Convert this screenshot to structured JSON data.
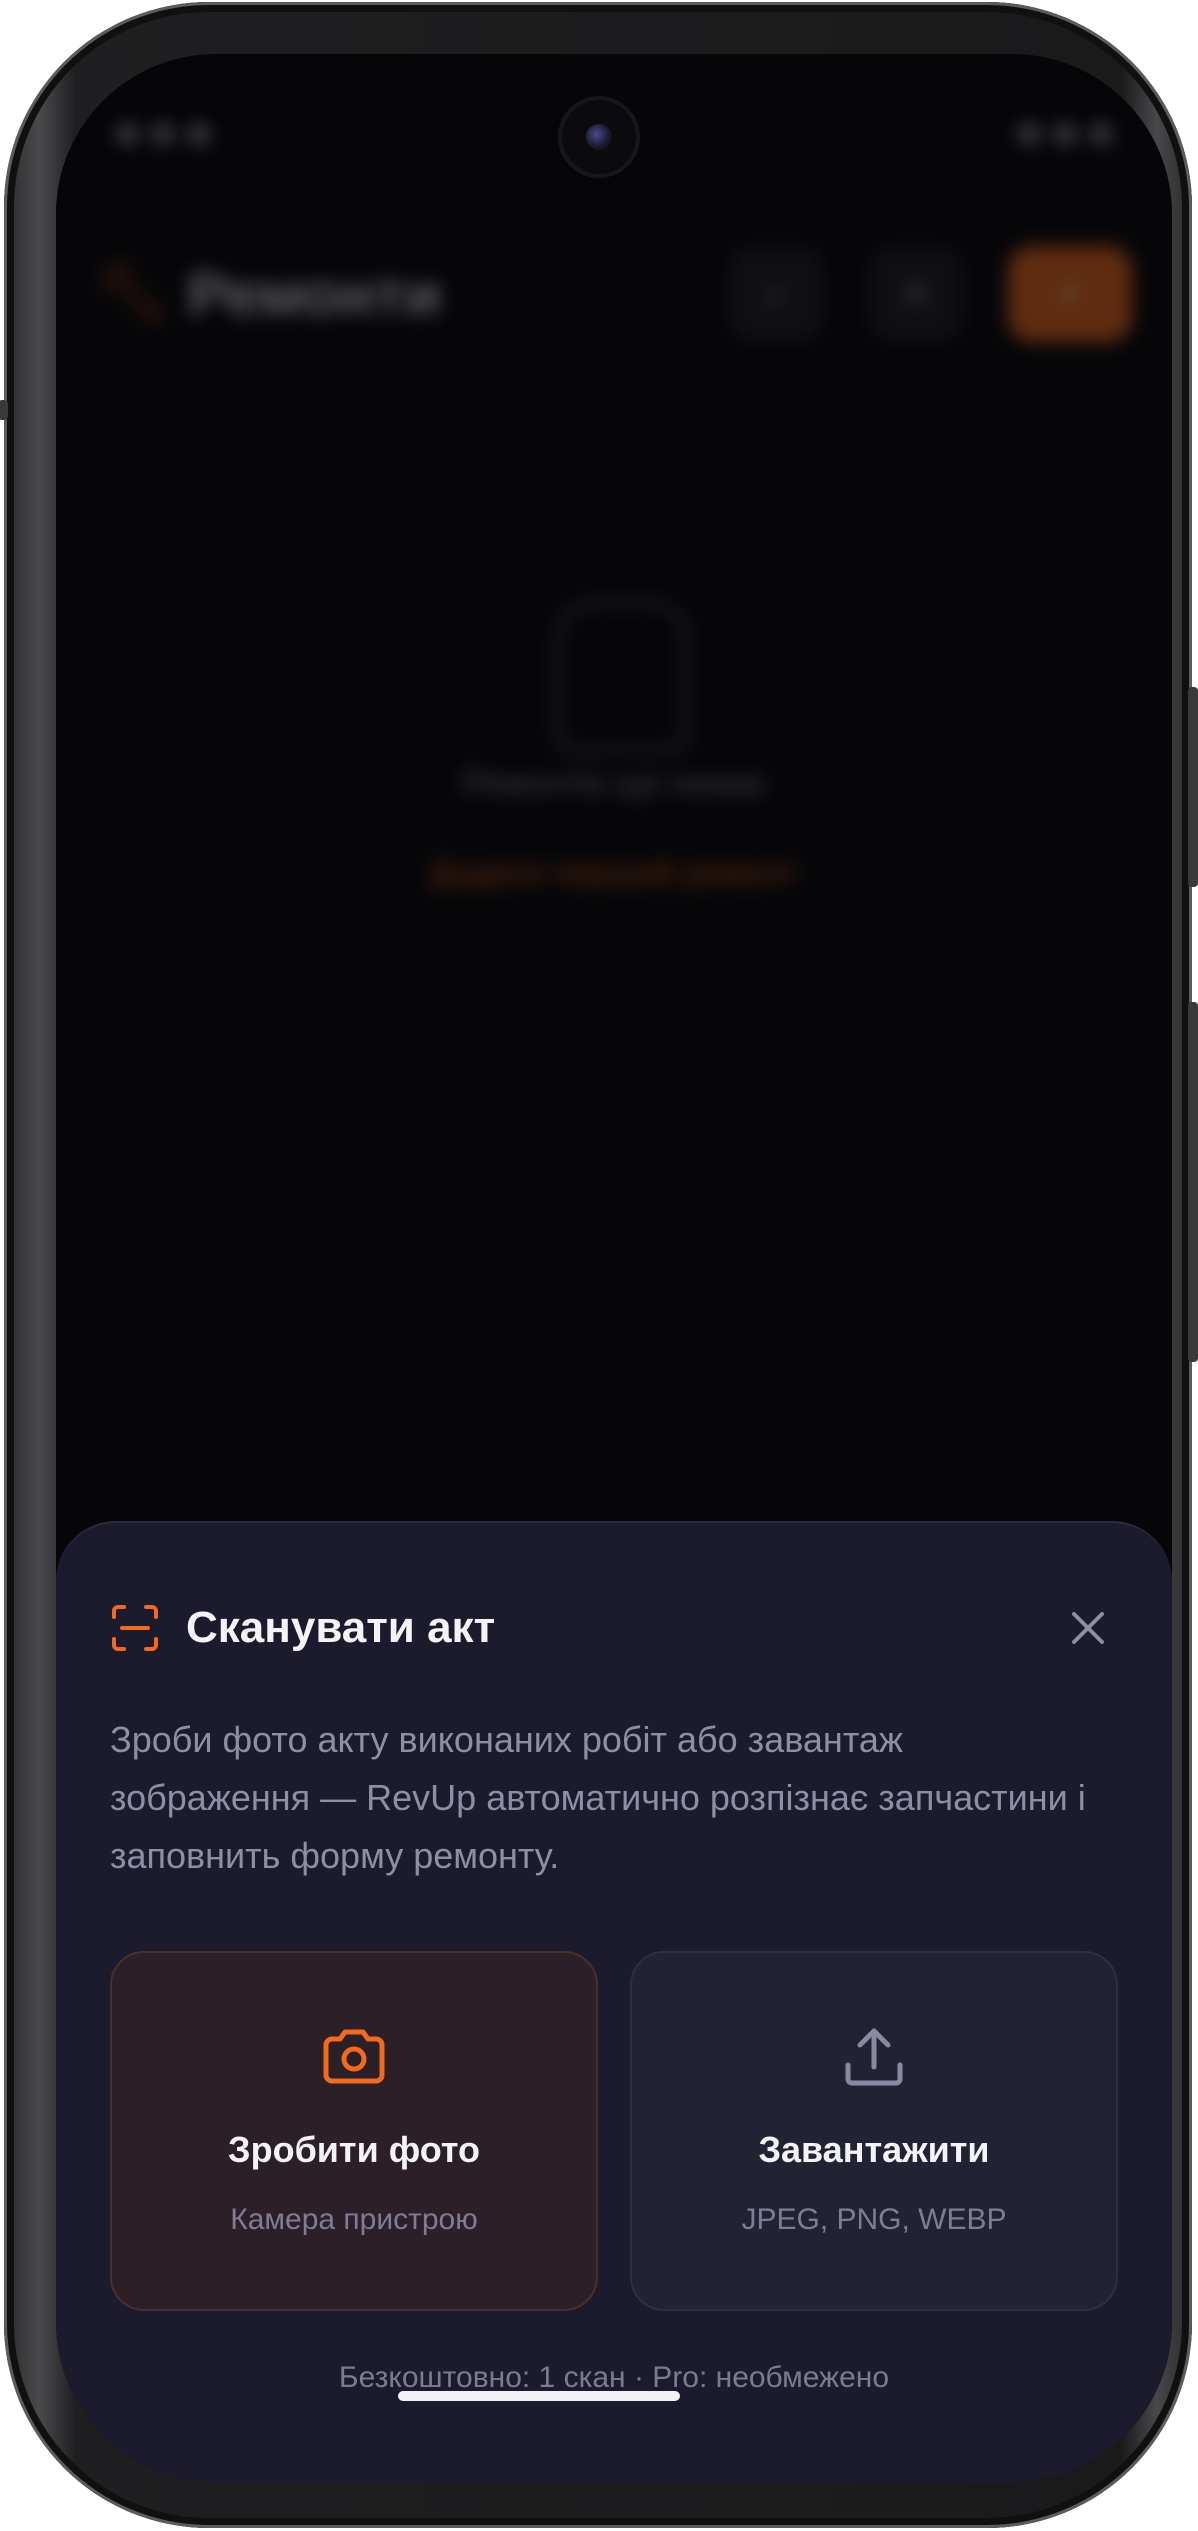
{
  "background_app": {
    "title": "Ремонти",
    "empty_text": "Ремонтів ще немає",
    "empty_link": "Додати перший ремонт",
    "header_buttons": [
      "search-icon",
      "filter-icon",
      "plus-icon"
    ]
  },
  "sheet": {
    "title": "Сканувати акт",
    "title_icon": "scan-icon",
    "description": "Зроби фото акту виконаних робіт або завантаж зображення — RevUp автоматично розпізнає запчастини і заповнить форму ремонту.",
    "options": [
      {
        "title": "Зробити фото",
        "subtitle": "Камера пристрою",
        "icon": "camera-icon"
      },
      {
        "title": "Завантажити",
        "subtitle": "JPEG, PNG, WEBP",
        "icon": "upload-icon"
      }
    ],
    "footer": "Безкоштовно: 1 скан · Pro: необмежено"
  },
  "colors": {
    "accent": "#f26a1b",
    "sheet_bg": "#1c1b2e",
    "screen_bg": "#060609"
  }
}
